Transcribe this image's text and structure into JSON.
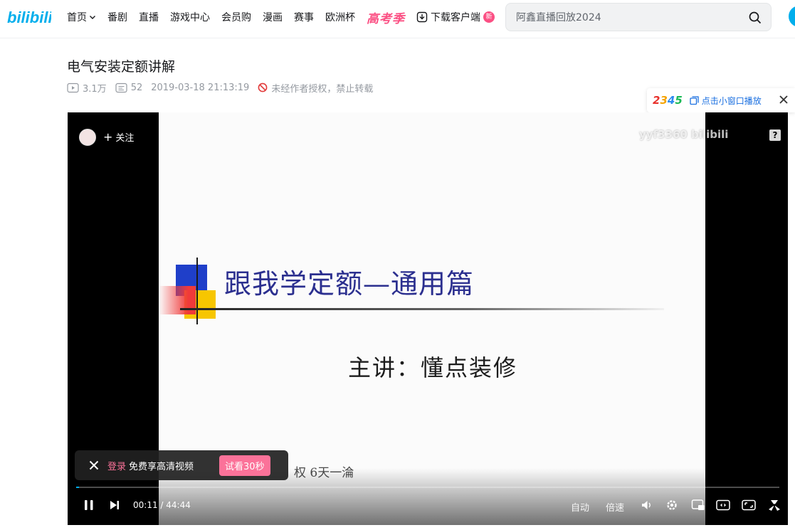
{
  "header": {
    "logo_text": "bilibili",
    "nav": [
      {
        "label": "首页",
        "has_dropdown": true
      },
      {
        "label": "番剧"
      },
      {
        "label": "直播"
      },
      {
        "label": "游戏中心"
      },
      {
        "label": "会员购"
      },
      {
        "label": "漫画"
      },
      {
        "label": "赛事"
      },
      {
        "label": "欧洲杯"
      }
    ],
    "gaokao_label": "高考季",
    "download_label": "下载客户端",
    "new_badge": "新",
    "search_placeholder": "阿鑫直播回放2024",
    "accent": "#fb7299",
    "brand_blue": "#00aeec"
  },
  "video": {
    "title": "电气安装定额讲解",
    "views": "3.1万",
    "danmaku": "52",
    "date": "2019-03-18 21:13:19",
    "copyright_notice": "未经作者授权，禁止转载"
  },
  "mini_window": {
    "brand": [
      "2",
      "3",
      "4",
      "5"
    ],
    "label": "点击小窗口播放"
  },
  "player": {
    "follow_label": "关注",
    "watermark": "yyf3360 bilibili",
    "slide_title": "跟我学定额—通用篇",
    "slide_sub": "主讲：懂点装修",
    "slide_bottom": "权  6天一淪",
    "current_time": "00:11",
    "duration": "44:44",
    "progress_fraction": 0.004,
    "quality_label": "自动",
    "speed_label": "倍速"
  },
  "login_toast": {
    "login_label": "登录",
    "text": "免费享高清视频",
    "trial_label": "试看30秒"
  }
}
